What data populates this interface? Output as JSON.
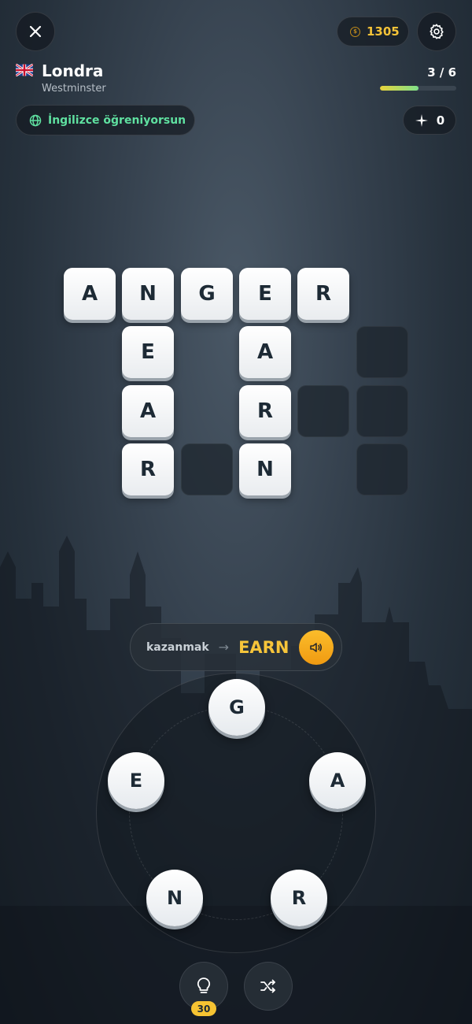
{
  "header": {
    "close_icon": "close-icon",
    "coins": "1305",
    "coin_icon": "coin-icon",
    "settings_icon": "gear-icon"
  },
  "location": {
    "flag": "uk-flag",
    "city": "Londra",
    "district": "Westminster"
  },
  "progress": {
    "text": "3 / 6",
    "fraction": 0.5
  },
  "learning": {
    "label": "İngilizce öğreniyorsun",
    "icon": "globe-icon"
  },
  "stars": {
    "icon": "sparkle-icon",
    "count": "0"
  },
  "grid": {
    "tiles": [
      {
        "letter": "A",
        "filled": true
      },
      {
        "letter": "N",
        "filled": true
      },
      {
        "letter": "G",
        "filled": true
      },
      {
        "letter": "E",
        "filled": true
      },
      {
        "letter": "R",
        "filled": true
      },
      {
        "letter": "E",
        "filled": true
      },
      {
        "letter": "A",
        "filled": true
      },
      {
        "letter": "",
        "filled": false
      },
      {
        "letter": "A",
        "filled": true
      },
      {
        "letter": "R",
        "filled": true
      },
      {
        "letter": "",
        "filled": false
      },
      {
        "letter": "",
        "filled": false
      },
      {
        "letter": "R",
        "filled": true
      },
      {
        "letter": "",
        "filled": false
      },
      {
        "letter": "N",
        "filled": true
      },
      {
        "letter": "",
        "filled": false
      }
    ]
  },
  "word_hint": {
    "translation": "kazanmak",
    "arrow": "→",
    "english": "EARN",
    "sound_icon": "speaker-icon"
  },
  "wheel": {
    "letters": [
      "G",
      "A",
      "R",
      "N",
      "E"
    ]
  },
  "bottom": {
    "hint_icon": "lightbulb-icon",
    "hint_count": "30",
    "shuffle_icon": "shuffle-icon"
  },
  "colors": {
    "accent": "#f7c53a",
    "learn_green": "#5fe0a0",
    "tile_text": "#1d2a35"
  }
}
